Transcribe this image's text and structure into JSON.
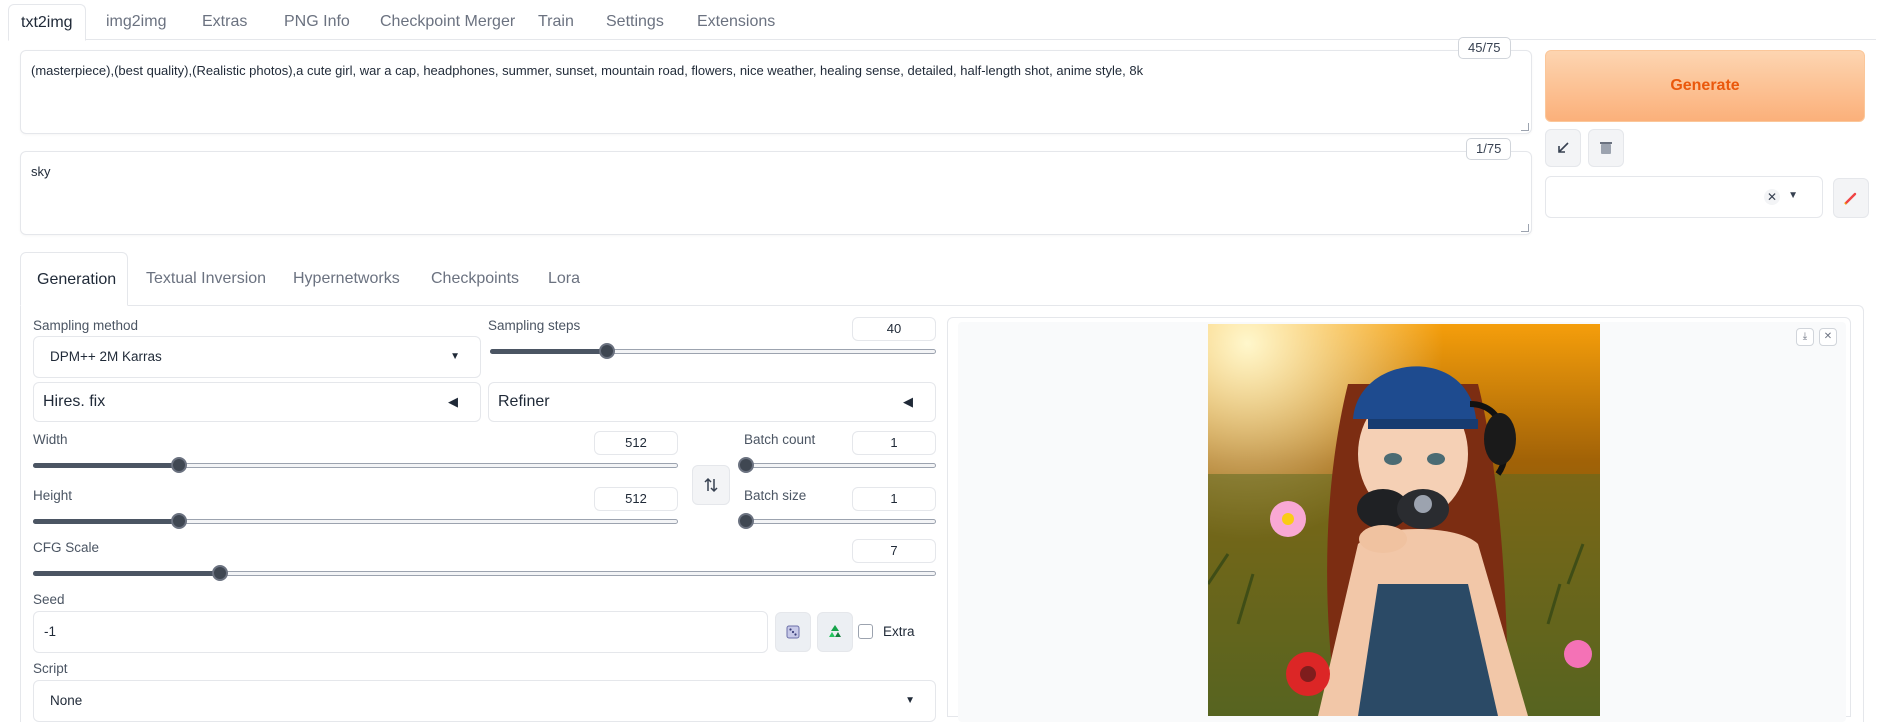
{
  "top_tabs": [
    {
      "label": "txt2img",
      "active": true
    },
    {
      "label": "img2img"
    },
    {
      "label": "Extras"
    },
    {
      "label": "PNG Info"
    },
    {
      "label": "Checkpoint Merger"
    },
    {
      "label": "Train"
    },
    {
      "label": "Settings"
    },
    {
      "label": "Extensions"
    }
  ],
  "prompt": {
    "text": "(masterpiece),(best quality),(Realistic photos),a cute girl, war a cap, headphones, summer, sunset, mountain road, flowers, nice weather, healing sense, detailed, half-length shot, anime style, 8k",
    "token_count": "45/75"
  },
  "negative_prompt": {
    "text": "sky",
    "token_count": "1/75"
  },
  "actions": {
    "generate_label": "Generate",
    "read_params_icon": "arrow-down-left-icon",
    "clear_icon": "trash-icon",
    "style_value": "",
    "edit_style_icon": "pencil-icon"
  },
  "inner_tabs": [
    {
      "label": "Generation",
      "active": true
    },
    {
      "label": "Textual Inversion"
    },
    {
      "label": "Hypernetworks"
    },
    {
      "label": "Checkpoints"
    },
    {
      "label": "Lora"
    }
  ],
  "generation": {
    "sampling_method": {
      "label": "Sampling method",
      "value": "DPM++ 2M Karras"
    },
    "sampling_steps": {
      "label": "Sampling steps",
      "value": "40",
      "min": 1,
      "max": 150,
      "current": 40
    },
    "hires_fix": {
      "label": "Hires. fix",
      "indicator": "◀"
    },
    "refiner": {
      "label": "Refiner",
      "indicator": "◀"
    },
    "width": {
      "label": "Width",
      "value": "512",
      "min": 64,
      "max": 2048,
      "current": 512
    },
    "height": {
      "label": "Height",
      "value": "512",
      "min": 64,
      "max": 2048,
      "current": 512
    },
    "batch_count": {
      "label": "Batch count",
      "value": "1",
      "min": 1,
      "max": 100,
      "current": 1
    },
    "batch_size": {
      "label": "Batch size",
      "value": "1",
      "min": 1,
      "max": 8,
      "current": 1
    },
    "cfg_scale": {
      "label": "CFG Scale",
      "value": "7",
      "min": 1,
      "max": 30,
      "current": 7
    },
    "seed": {
      "label": "Seed",
      "value": "-1",
      "dice_icon": "dice-icon",
      "recycle_icon": "recycle-icon",
      "extra_label": "Extra"
    },
    "script": {
      "label": "Script",
      "value": "None"
    }
  },
  "output": {
    "download_icon": "download-icon",
    "close_icon": "close-icon",
    "image_description_icon": "generated-image"
  },
  "colors": {
    "generate_bg_top": "#fdd5b1",
    "generate_bg_bottom": "#fbb07a",
    "generate_text": "#ea580c",
    "slider_thumb": "#3f4752"
  }
}
